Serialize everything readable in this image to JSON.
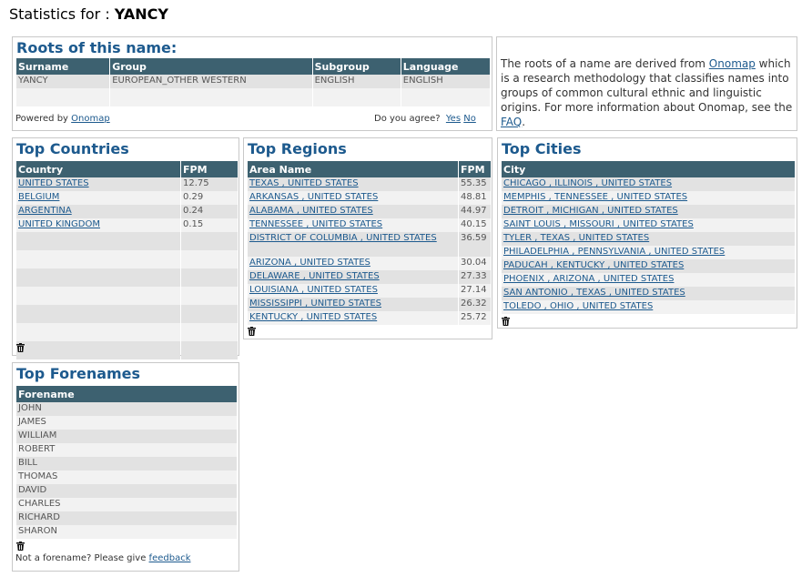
{
  "page": {
    "title_prefix": "Statistics for : ",
    "surname": "YANCY"
  },
  "roots": {
    "title": "Roots of this name:",
    "headers": [
      "Surname",
      "Group",
      "Subgroup",
      "Language"
    ],
    "row": [
      "YANCY",
      "EUROPEAN_OTHER WESTERN",
      "ENGLISH",
      "ENGLISH"
    ],
    "powered_by": "Powered by",
    "powered_link": "Onomap",
    "agree_prompt": "Do you agree?",
    "yes": "Yes",
    "no": "No"
  },
  "info": {
    "text_before": "The roots of a name are derived from ",
    "onomap_link": "Onomap",
    "text_middle": " which is a research methodology that classifies names into groups of common cultural ethnic and linguistic origins. For more information about Onomap, see the ",
    "faq_link": "FAQ",
    "text_after": "."
  },
  "countries": {
    "title": "Top Countries",
    "headers": [
      "Country",
      "FPM"
    ],
    "rows": [
      {
        "name": "UNITED STATES",
        "fpm": "12.75"
      },
      {
        "name": "BELGIUM",
        "fpm": "0.29"
      },
      {
        "name": "ARGENTINA",
        "fpm": "0.24"
      },
      {
        "name": "UNITED KINGDOM",
        "fpm": "0.15"
      }
    ]
  },
  "regions": {
    "title": "Top Regions",
    "headers": [
      "Area Name",
      "FPM"
    ],
    "rows": [
      {
        "name": "TEXAS , UNITED STATES",
        "fpm": "55.35"
      },
      {
        "name": "ARKANSAS , UNITED STATES",
        "fpm": "48.81"
      },
      {
        "name": "ALABAMA , UNITED STATES",
        "fpm": "44.97"
      },
      {
        "name": "TENNESSEE , UNITED STATES",
        "fpm": "40.15"
      },
      {
        "name": "DISTRICT OF COLUMBIA , UNITED STATES",
        "fpm": "36.59"
      },
      {
        "name": "ARIZONA , UNITED STATES",
        "fpm": "30.04"
      },
      {
        "name": "DELAWARE , UNITED STATES",
        "fpm": "27.33"
      },
      {
        "name": "LOUISIANA , UNITED STATES",
        "fpm": "27.14"
      },
      {
        "name": "MISSISSIPPI , UNITED STATES",
        "fpm": "26.32"
      },
      {
        "name": "KENTUCKY , UNITED STATES",
        "fpm": "25.72"
      }
    ]
  },
  "cities": {
    "title": "Top Cities",
    "headers": [
      "City"
    ],
    "rows": [
      "CHICAGO , ILLINOIS , UNITED STATES",
      "MEMPHIS , TENNESSEE , UNITED STATES",
      "DETROIT , MICHIGAN , UNITED STATES",
      "SAINT LOUIS , MISSOURI , UNITED STATES",
      "TYLER , TEXAS , UNITED STATES",
      "PHILADELPHIA , PENNSYLVANIA , UNITED STATES",
      "PADUCAH , KENTUCKY , UNITED STATES",
      "PHOENIX , ARIZONA , UNITED STATES",
      "SAN ANTONIO , TEXAS , UNITED STATES",
      "TOLEDO , OHIO , UNITED STATES"
    ]
  },
  "forenames": {
    "title": "Top Forenames",
    "headers": [
      "Forename"
    ],
    "rows": [
      "JOHN",
      "JAMES",
      "WILLIAM",
      "ROBERT",
      "BILL",
      "THOMAS",
      "DAVID",
      "CHARLES",
      "RICHARD",
      "SHARON"
    ],
    "feedback_prompt": "Not a forename? Please give",
    "feedback_link": "feedback"
  },
  "icons": {
    "delete": "trash-icon"
  }
}
